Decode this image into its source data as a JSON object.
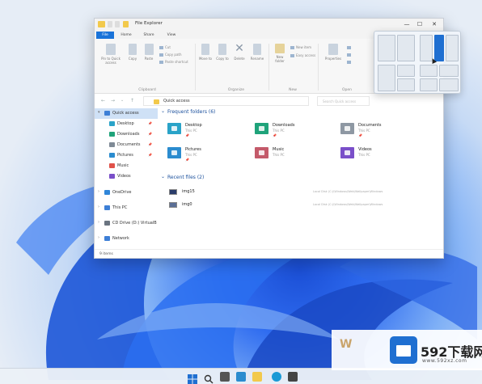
{
  "window": {
    "title": "File Explorer",
    "controls": {
      "minimize": "—",
      "maximize": "☐",
      "close": "✕"
    }
  },
  "ribbon": {
    "tabs": [
      {
        "label": "File",
        "active": true
      },
      {
        "label": "Home",
        "active": false
      },
      {
        "label": "Share",
        "active": false
      },
      {
        "label": "View",
        "active": false
      }
    ],
    "clipboard": {
      "pin": "Pin to Quick access",
      "copy": "Copy",
      "paste": "Paste",
      "cut": "Cut",
      "copy_path": "Copy path",
      "paste_shortcut": "Paste shortcut",
      "group": "Clipboard"
    },
    "organize": {
      "move_to": "Move to",
      "copy_to": "Copy to",
      "delete": "Delete",
      "rename": "Rename",
      "group": "Organize"
    },
    "new": {
      "new_folder": "New folder",
      "new_item": "New item",
      "easy_access": "Easy access",
      "group": "New"
    },
    "open": {
      "properties": "Properties",
      "group": "Open"
    }
  },
  "address": {
    "back": "←",
    "forward": "→",
    "up": "↑",
    "breadcrumb": "Quick access",
    "search_placeholder": "Search Quick access"
  },
  "sidebar": {
    "items": [
      {
        "label": "Quick access",
        "icon": "star-icon",
        "color": "#3d7fd6",
        "selected": true,
        "chevron": "▾",
        "pinned": false
      },
      {
        "label": "Desktop",
        "icon": "desktop-icon",
        "color": "#2aa3c8",
        "selected": false,
        "chevron": "",
        "pinned": true
      },
      {
        "label": "Downloads",
        "icon": "downloads-icon",
        "color": "#1fa37a",
        "selected": false,
        "chevron": "",
        "pinned": true
      },
      {
        "label": "Documents",
        "icon": "documents-icon",
        "color": "#7f8a96",
        "selected": false,
        "chevron": "",
        "pinned": true
      },
      {
        "label": "Pictures",
        "icon": "pictures-icon",
        "color": "#2b8ccf",
        "selected": false,
        "chevron": "",
        "pinned": true
      },
      {
        "label": "Music",
        "icon": "music-icon",
        "color": "#e0524a",
        "selected": false,
        "chevron": "",
        "pinned": false
      },
      {
        "label": "Videos",
        "icon": "videos-icon",
        "color": "#7a4fc9",
        "selected": false,
        "chevron": "",
        "pinned": false
      },
      {
        "label": "OneDrive",
        "icon": "cloud-icon",
        "color": "#2f86d9",
        "selected": false,
        "chevron": "›",
        "pinned": false
      },
      {
        "label": "This PC",
        "icon": "pc-icon",
        "color": "#3d7fd6",
        "selected": false,
        "chevron": "›",
        "pinned": false
      },
      {
        "label": "CD Drive (D:) VirtualB",
        "icon": "cd-drive-icon",
        "color": "#6a7480",
        "selected": false,
        "chevron": "›",
        "pinned": false
      },
      {
        "label": "Network",
        "icon": "network-icon",
        "color": "#3d7fd6",
        "selected": false,
        "chevron": "›",
        "pinned": false
      }
    ],
    "pin_glyph": "📌"
  },
  "frequent": {
    "title": "Frequent folders (6)",
    "chevron": "⌄",
    "folders": [
      {
        "name": "Desktop",
        "location": "This PC",
        "color": "#2aa3c8"
      },
      {
        "name": "Downloads",
        "location": "This PC",
        "color": "#1fa37a"
      },
      {
        "name": "Documents",
        "location": "This PC",
        "color": "#8e98a3"
      },
      {
        "name": "Pictures",
        "location": "This PC",
        "color": "#2b8ccf"
      },
      {
        "name": "Music",
        "location": "This PC",
        "color": "#c45a6a"
      },
      {
        "name": "Videos",
        "location": "This PC",
        "color": "#7a4fc9"
      }
    ],
    "pin_glyph": "📌"
  },
  "recent": {
    "title": "Recent files (2)",
    "chevron": "⌄",
    "files": [
      {
        "name": "img15",
        "path": "Local Disk (C:)\\Windows\\Web\\Wallpaper\\Windows"
      },
      {
        "name": "img0",
        "path": "Local Disk (C:)\\Windows\\Web\\Wallpaper\\Windows"
      }
    ]
  },
  "status": {
    "items": "9 items"
  },
  "taskbar": {
    "icons": [
      {
        "name": "start-icon",
        "color": "#1f6fd1"
      },
      {
        "name": "search-icon",
        "color": "#333333"
      },
      {
        "name": "task-view-icon",
        "color": "#555555"
      },
      {
        "name": "widgets-icon",
        "color": "#2b8ccf"
      },
      {
        "name": "file-explorer-icon",
        "color": "#f2c94c"
      },
      {
        "name": "edge-icon",
        "color": "#1a9ad6"
      },
      {
        "name": "store-icon",
        "color": "#444444"
      }
    ]
  },
  "watermark": {
    "brand": "592下载网",
    "sub": "www.592xz.com",
    "win_mark": "W"
  }
}
